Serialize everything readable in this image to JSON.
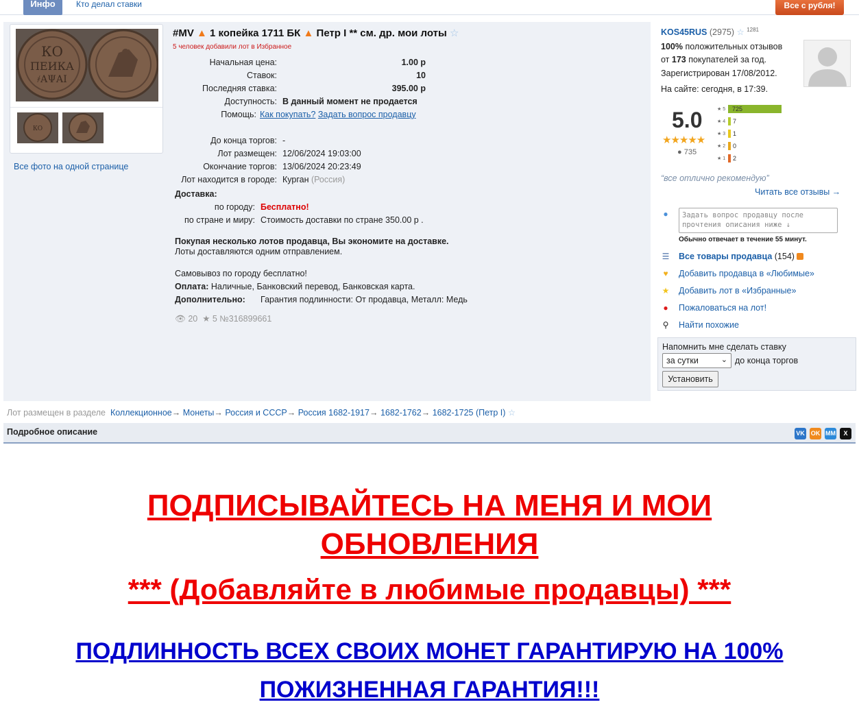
{
  "tabs": {
    "info": "Инфо",
    "bids": "Кто делал ставки"
  },
  "promo_button": "Все с рубля!",
  "lot": {
    "tag": "#MV",
    "name": "1 копейка 1711 БК",
    "subtitle": "Петр I ** см. др. мои лоты",
    "favorites_note": "5 человек добавили лот в Избранное",
    "fields": {
      "start_price_label": "Начальная цена:",
      "start_price": "1.00 р",
      "bids_label": "Ставок:",
      "bids": "10",
      "last_bid_label": "Последняя ставка:",
      "last_bid": "395.00 р",
      "availability_label": "Доступность:",
      "availability": "В данный момент не продается",
      "help_label": "Помощь:",
      "help_link1": "Как покупать?",
      "help_link2": "Задать вопрос продавцу",
      "time_left_label": "До конца торгов:",
      "time_left": "-",
      "placed_label": "Лот размещен:",
      "placed": "12/06/2024 19:03:00",
      "ends_label": "Окончание торгов:",
      "ends": "13/06/2024 20:23:49",
      "city_label": "Лот находится в городе:",
      "city": "Курган",
      "country": "(Россия)"
    },
    "delivery": {
      "title": "Доставка:",
      "city_label": "по городу:",
      "city_value": "Бесплатно!",
      "country_label": "по стране и миру:",
      "country_value": "Стоимость доставки по стране 350.00 р ."
    },
    "savings_bold": "Покупая несколько лотов продавца, Вы экономите на доставке.",
    "savings_note": "Лоты доставляются одним отправлением.",
    "pickup": "Самовывоз по городу бесплатно!",
    "payment_label": "Оплата:",
    "payment_value": "Наличные, Банковский перевод, Банковская карта.",
    "extra_label": "Дополнительно:",
    "extra_value": "Гарантия подлинности: От продавца, Металл: Медь",
    "views": "20",
    "stars": "5",
    "lot_number": "№316899661",
    "all_photos": "Все фото на одной странице"
  },
  "breadcrumb": {
    "prefix": "Лот размещен в разделе",
    "items": [
      "Коллекционное",
      "Монеты",
      "Россия и СССР",
      "Россия 1682-1917",
      "1682-1762",
      "1682-1725 (Петр I)"
    ]
  },
  "description_title": "Подробное описание",
  "share": [
    "VK",
    "OK",
    "MM",
    "X"
  ],
  "seller": {
    "name": "KOS45RUS",
    "score": "(2975)",
    "badge": "1281",
    "positive_pct": "100%",
    "positive_text": "положительных отзывов",
    "from": "от",
    "buyers": "173",
    "buyers_text": "покупателей за год.",
    "registered": "Зарегистрирован 17/08/2012.",
    "online": "На сайте: сегодня, в 17:39.",
    "rating": "5.0",
    "stars_glyph": "★★★★★",
    "reviews_total": "735",
    "quote": "“все отлично рекомендую”",
    "read_all": "Читать все отзывы →",
    "ask_placeholder": "Задать вопрос продавцу после прочтения описания ниже ↓",
    "reply_time": "Обычно отвечает в течение 55 минут.",
    "all_items": "Все товары продавца",
    "all_items_count": "(154)",
    "add_seller": "Добавить продавца в «Любимые»",
    "add_lot": "Добавить лот в «Избранные»",
    "complain": "Пожаловаться на лот!",
    "similar": "Найти похожие"
  },
  "rating_bars": [
    {
      "stars": "5",
      "count": 725,
      "color": "#8ab52c"
    },
    {
      "stars": "4",
      "count": 7,
      "color": "#b5cc2e"
    },
    {
      "stars": "3",
      "count": 1,
      "color": "#e8c91e"
    },
    {
      "stars": "2",
      "count": 0,
      "color": "#e8a81e"
    },
    {
      "stars": "1",
      "count": 2,
      "color": "#e06a2a"
    }
  ],
  "reminder": {
    "title": "Напомнить мне сделать ставку",
    "selected": "за сутки",
    "suffix": "до конца торгов",
    "button": "Установить"
  },
  "promo": {
    "line1": " ПОДПИСЫВАЙТЕСЬ НА МЕНЯ И МОИ",
    "line2": "ОБНОВЛЕНИЯ",
    "line3": "*** (Добавляйте в любимые продавцы) ***",
    "line4": "ПОДЛИННОСТЬ ВСЕХ СВОИХ МОНЕТ ГАРАНТИРУЮ НА 100%",
    "line5": "ПОЖИЗНЕННАЯ ГАРАНТИЯ!!!"
  },
  "colors": {
    "accent_link": "#1b5fa8",
    "promo_red": "#ee0000",
    "promo_blue": "#0000cc",
    "panel_bg": "#eef1f6"
  }
}
